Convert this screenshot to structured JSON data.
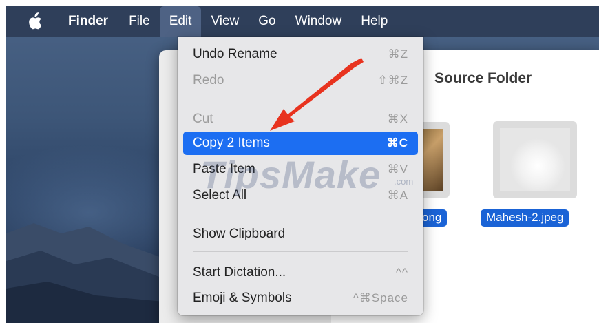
{
  "menubar": {
    "items": [
      "Finder",
      "File",
      "Edit",
      "View",
      "Go",
      "Window",
      "Help"
    ],
    "active": "Edit"
  },
  "edit_menu": {
    "items": [
      {
        "label": "Undo Rename",
        "shortcut": "⌘Z",
        "enabled": true
      },
      {
        "label": "Redo",
        "shortcut": "⇧⌘Z",
        "enabled": false
      },
      {
        "label": "Cut",
        "shortcut": "⌘X",
        "enabled": false
      },
      {
        "label": "Copy 2 Items",
        "shortcut": "⌘C",
        "enabled": true,
        "selected": true
      },
      {
        "label": "Paste Item",
        "shortcut": "⌘V",
        "enabled": true
      },
      {
        "label": "Select All",
        "shortcut": "⌘A",
        "enabled": true
      },
      {
        "label": "Show Clipboard",
        "shortcut": "",
        "enabled": true
      },
      {
        "label": "Start Dictation...",
        "shortcut": "^^",
        "enabled": true
      },
      {
        "label": "Emoji & Symbols",
        "shortcut": "^⌘Space",
        "enabled": true
      }
    ]
  },
  "finder": {
    "folder_title": "Source Folder",
    "files": [
      "ong",
      "Mahesh-2.jpeg"
    ]
  },
  "watermark": {
    "text": "TipsMake",
    "suffix": ".com"
  },
  "colors": {
    "selection": "#1c6ef2",
    "arrow": "#e8331f",
    "menubar": "#2f3f5a"
  }
}
